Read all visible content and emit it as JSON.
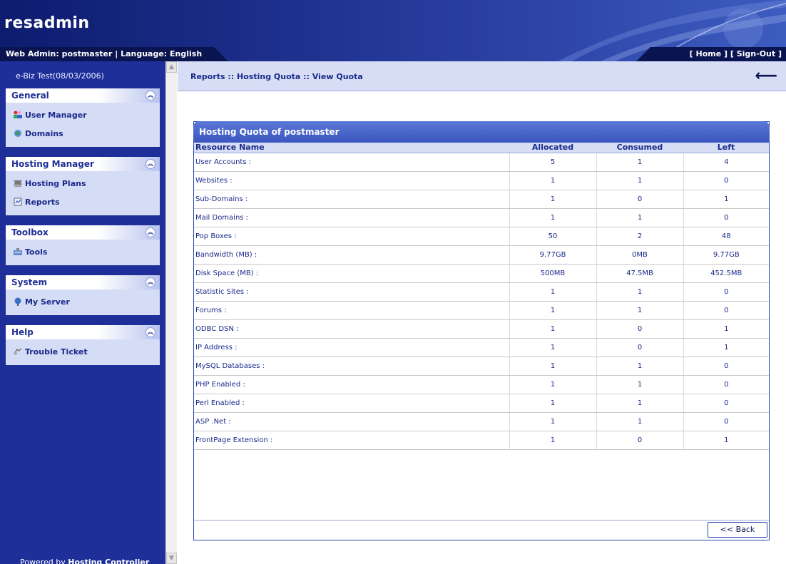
{
  "app": {
    "title": "resadmin",
    "web_admin_label": "Web Admin: postmaster | Language: English",
    "nav_home": "[ Home ]",
    "nav_signout": "[ Sign-Out ]"
  },
  "sidebar": {
    "user_info": "e-Biz Test(08/03/2006)",
    "panels": [
      {
        "title": "General",
        "items": [
          {
            "label": "User Manager",
            "icon": "users-icon"
          },
          {
            "label": "Domains",
            "icon": "globe-icon"
          }
        ]
      },
      {
        "title": "Hosting Manager",
        "items": [
          {
            "label": "Hosting Plans",
            "icon": "plans-icon"
          },
          {
            "label": "Reports",
            "icon": "reports-icon"
          }
        ]
      },
      {
        "title": "Toolbox",
        "items": [
          {
            "label": "Tools",
            "icon": "tools-icon"
          }
        ]
      },
      {
        "title": "System",
        "items": [
          {
            "label": "My Server",
            "icon": "server-icon"
          }
        ]
      },
      {
        "title": "Help",
        "items": [
          {
            "label": "Trouble Ticket",
            "icon": "ticket-icon"
          }
        ]
      }
    ],
    "powered_prefix": "Powered by ",
    "powered_brand": "Hosting Controller"
  },
  "breadcrumb": "Reports :: Hosting Quota :: View Quota",
  "quota": {
    "title": "Hosting Quota of postmaster",
    "columns": [
      "Resource Name",
      "Allocated",
      "Consumed",
      "Left"
    ],
    "rows": [
      [
        "User Accounts :",
        "5",
        "1",
        "4"
      ],
      [
        "Websites :",
        "1",
        "1",
        "0"
      ],
      [
        "Sub-Domains :",
        "1",
        "0",
        "1"
      ],
      [
        "Mail Domains :",
        "1",
        "1",
        "0"
      ],
      [
        "Pop Boxes :",
        "50",
        "2",
        "48"
      ],
      [
        "Bandwidth (MB) :",
        "9.77GB",
        "0MB",
        "9.77GB"
      ],
      [
        "Disk Space (MB) :",
        "500MB",
        "47.5MB",
        "452.5MB"
      ],
      [
        "Statistic Sites :",
        "1",
        "1",
        "0"
      ],
      [
        "Forums :",
        "1",
        "1",
        "0"
      ],
      [
        "ODBC DSN :",
        "1",
        "0",
        "1"
      ],
      [
        "IP Address :",
        "1",
        "0",
        "1"
      ],
      [
        "MySQL Databases :",
        "1",
        "1",
        "0"
      ],
      [
        "PHP Enabled :",
        "1",
        "1",
        "0"
      ],
      [
        "Perl Enabled :",
        "1",
        "1",
        "0"
      ],
      [
        "ASP .Net :",
        "1",
        "1",
        "0"
      ],
      [
        "FrontPage Extension :",
        "1",
        "0",
        "1"
      ]
    ],
    "back_label": "<< Back"
  }
}
